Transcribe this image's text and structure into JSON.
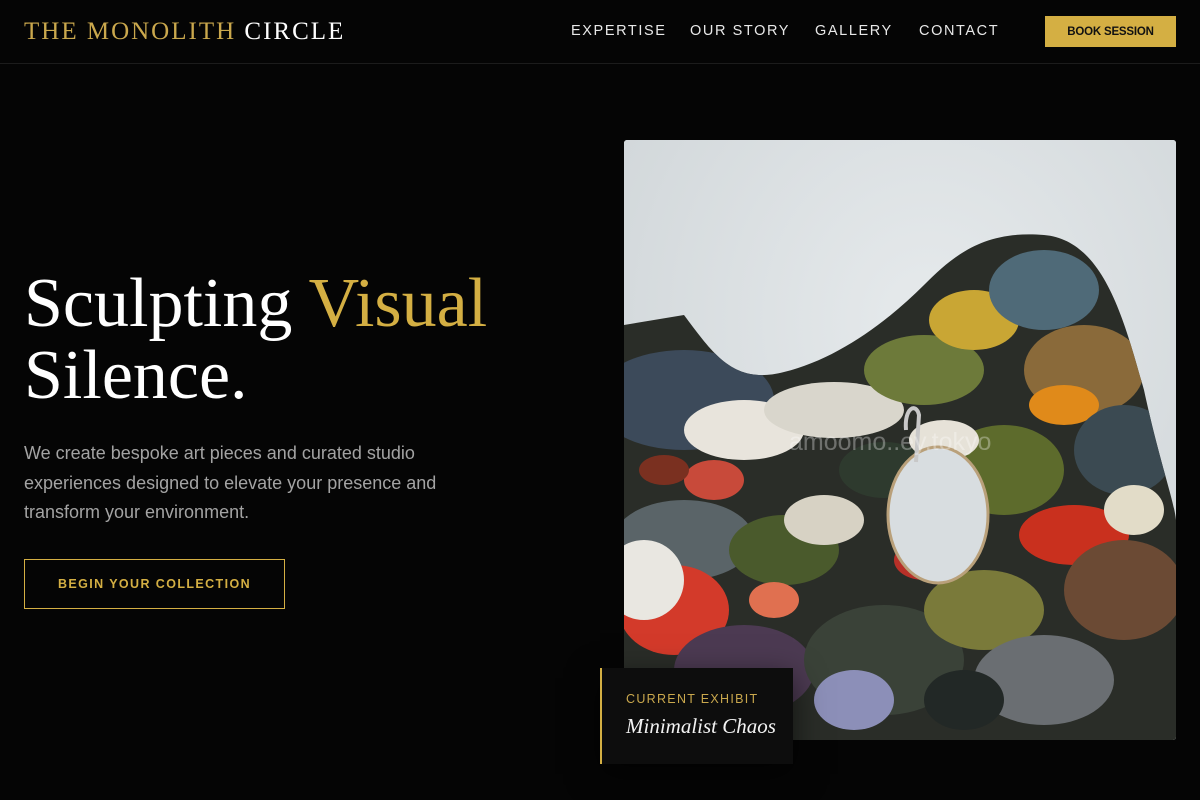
{
  "brand": {
    "name_part1": "THE MONOLITH",
    "name_part2": "CIRCLE"
  },
  "nav": {
    "items": [
      {
        "label": "EXPERTISE"
      },
      {
        "label": "OUR STORY"
      },
      {
        "label": "GALLERY"
      },
      {
        "label": "CONTACT"
      }
    ],
    "cta_label": "BOOK SESSION"
  },
  "hero": {
    "headline_part1": "Sculpting",
    "headline_accent": "Visual",
    "headline_part2": "Silence.",
    "description": "We create bespoke art pieces and curated studio experiences designed to elevate your presence and transform your environment.",
    "cta_label": "BEGIN YOUR COLLECTION"
  },
  "exhibit": {
    "label": "CURRENT EXHIBIT",
    "title": "Minimalist Chaos"
  },
  "image": {
    "subject": "paint-palette-photo",
    "watermark_text": "amoomo..ey.tokyo"
  },
  "colors": {
    "background": "#050505",
    "accent": "#d4af43",
    "text": "#ffffff",
    "muted": "#a3a3a3"
  }
}
